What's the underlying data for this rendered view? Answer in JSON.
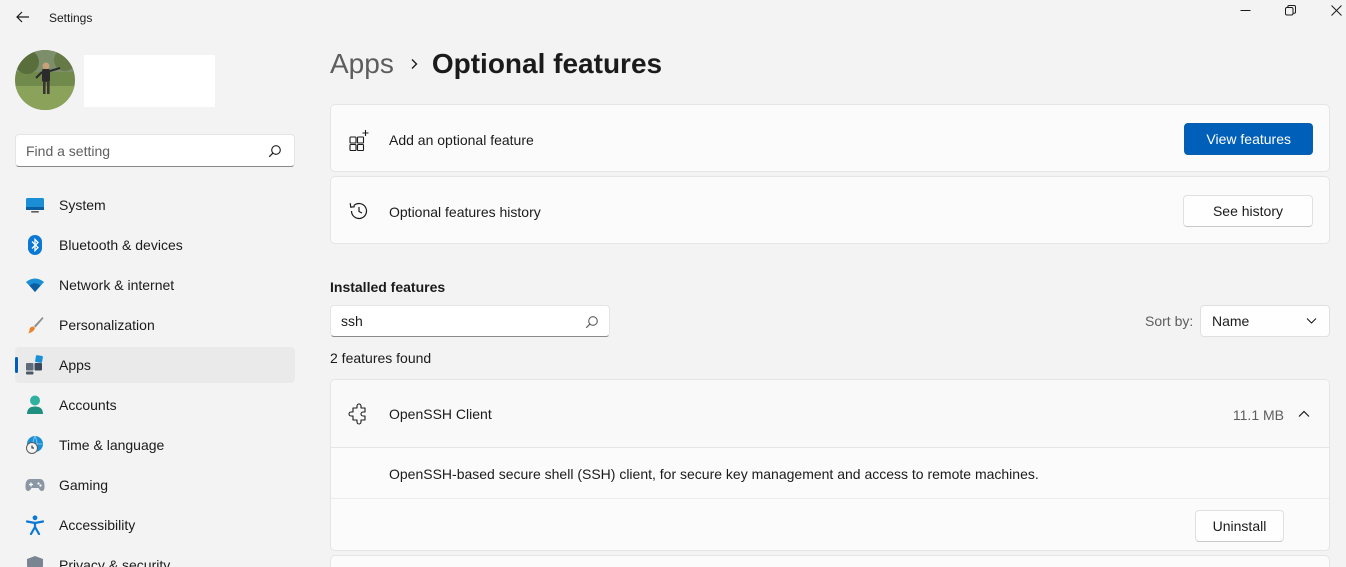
{
  "window": {
    "title": "Settings",
    "minimize_icon": "minimize-icon",
    "restore_icon": "restore-icon",
    "close_icon": "close-icon"
  },
  "sidebar": {
    "search_placeholder": "Find a setting",
    "items": [
      {
        "label": "System",
        "icon": "system-icon"
      },
      {
        "label": "Bluetooth & devices",
        "icon": "bluetooth-icon"
      },
      {
        "label": "Network & internet",
        "icon": "wifi-icon"
      },
      {
        "label": "Personalization",
        "icon": "brush-icon"
      },
      {
        "label": "Apps",
        "icon": "apps-icon",
        "active": true
      },
      {
        "label": "Accounts",
        "icon": "person-icon"
      },
      {
        "label": "Time & language",
        "icon": "globe-clock-icon"
      },
      {
        "label": "Gaming",
        "icon": "gamepad-icon"
      },
      {
        "label": "Accessibility",
        "icon": "accessibility-icon"
      },
      {
        "label": "Privacy & security",
        "icon": "shield-icon"
      }
    ]
  },
  "breadcrumb": {
    "parent": "Apps",
    "current": "Optional features"
  },
  "add_feature": {
    "label": "Add an optional feature",
    "button": "View features"
  },
  "history": {
    "label": "Optional features history",
    "button": "See history"
  },
  "installed": {
    "title": "Installed features",
    "search_value": "ssh",
    "sort_label": "Sort by:",
    "sort_value": "Name",
    "count_text": "2 features found"
  },
  "feature": {
    "name": "OpenSSH Client",
    "size": "11.1 MB",
    "description": "OpenSSH-based secure shell (SSH) client, for secure key management and access to remote machines.",
    "uninstall": "Uninstall",
    "expanded": true
  },
  "colors": {
    "accent": "#005fb8",
    "background": "#f3f3f3",
    "card": "#fbfbfb"
  }
}
